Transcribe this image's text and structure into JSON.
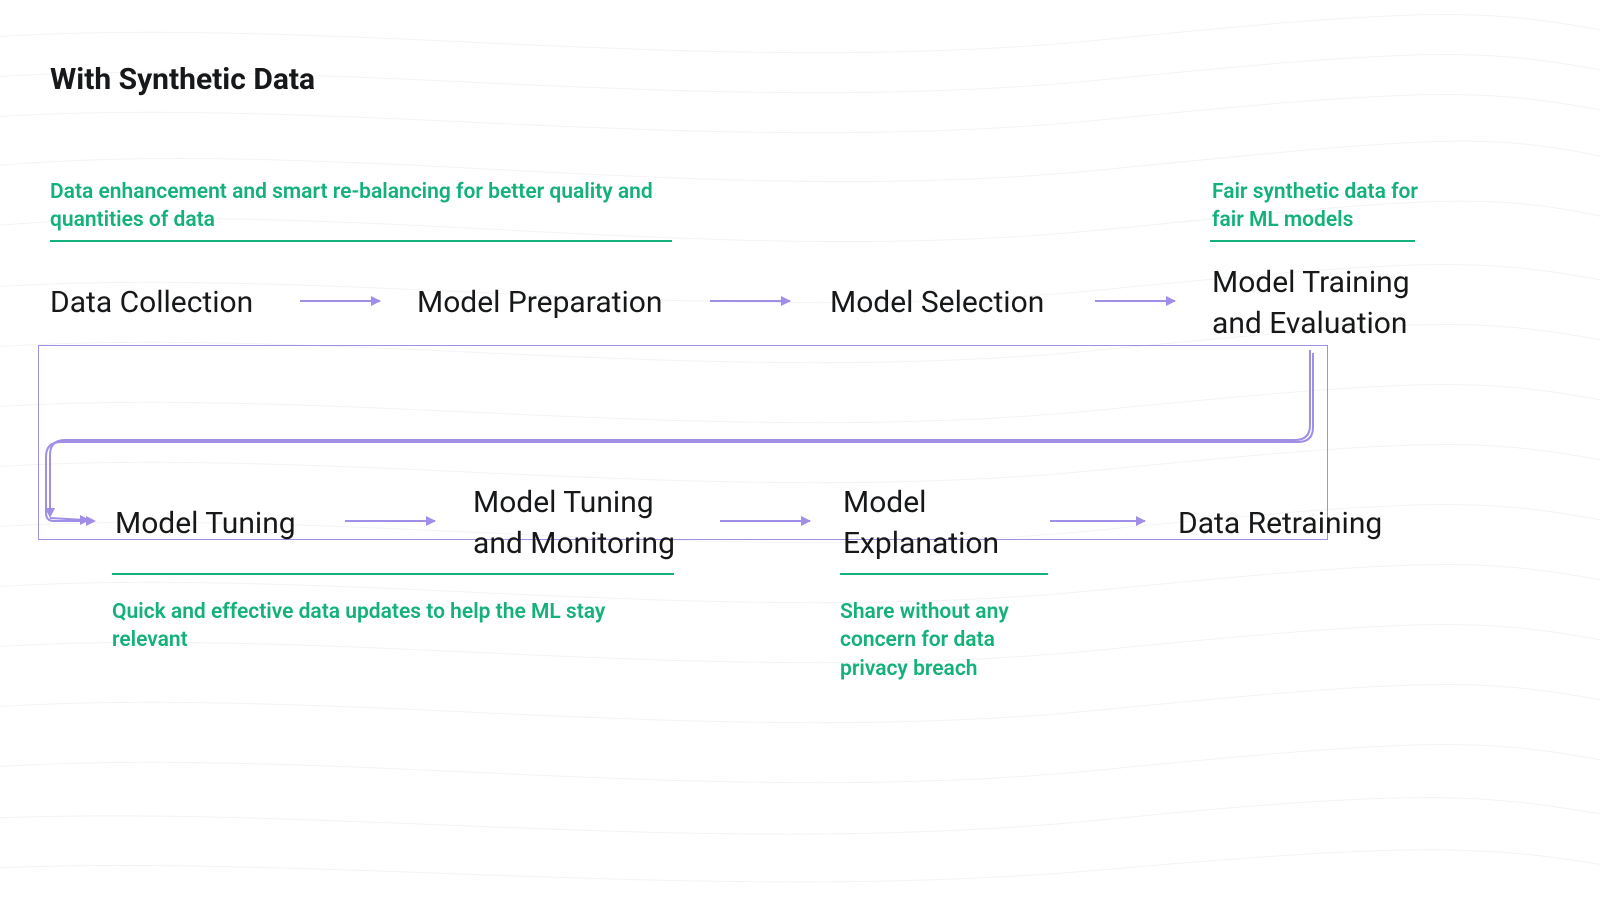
{
  "title": "With Synthetic Data",
  "stages": {
    "s1": "Data Collection",
    "s2": "Model Preparation",
    "s3": "Model Selection",
    "s4": "Model Training\nand Evaluation",
    "s5": "Model Tuning",
    "s6": "Model Tuning\nand Monitoring",
    "s7": "Model\nExplanation",
    "s8": "Data Retraining"
  },
  "annotations": {
    "a1": "Data enhancement and smart re-balancing for better quality and quantities of data",
    "a2": "Fair synthetic data for fair ML models",
    "a3": "Quick and effective data updates to help the ML stay relevant",
    "a4": "Share without any concern for data privacy breach"
  },
  "colors": {
    "accent_green": "#14b17a",
    "arrow_purple": "#a18ee6",
    "text": "#17181a"
  }
}
